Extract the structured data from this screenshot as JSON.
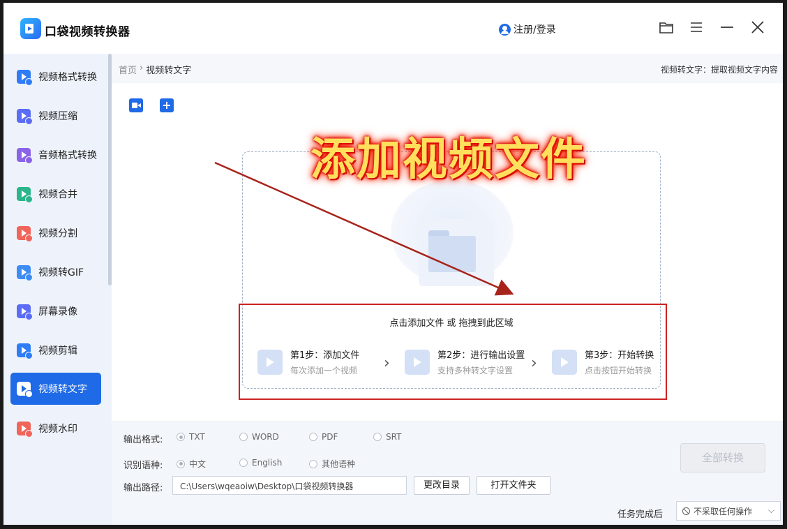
{
  "app": {
    "title": "口袋视频转换器",
    "user_link": "注册/登录"
  },
  "sidebar": {
    "items": [
      {
        "label": "视频格式转换",
        "color": "#2f7cf6"
      },
      {
        "label": "视频压缩",
        "color": "#5b6cf5"
      },
      {
        "label": "音频格式转换",
        "color": "#8a63e8"
      },
      {
        "label": "视频合并",
        "color": "#2bb58a"
      },
      {
        "label": "视频分割",
        "color": "#f0645a"
      },
      {
        "label": "视频转GIF",
        "color": "#3d8cf5"
      },
      {
        "label": "屏幕录像",
        "color": "#5b6cf5"
      },
      {
        "label": "视频剪辑",
        "color": "#2f7cf6"
      },
      {
        "label": "视频转文字",
        "color": "#1f6ae6",
        "active": true
      },
      {
        "label": "视频水印",
        "color": "#f0645a"
      }
    ]
  },
  "breadcrumb": {
    "home": "首页",
    "separator": "›",
    "current": "视频转文字",
    "right_text": "视频转文字：提取视频文字内容"
  },
  "overlay": {
    "title": "添加视频文件"
  },
  "dropzone": {
    "hint": "点击添加文件 或 拖拽到此区域",
    "steps": [
      {
        "title": "第1步：添加文件",
        "sub": "每次添加一个视频"
      },
      {
        "title": "第2步：进行输出设置",
        "sub": "支持多种转文字设置"
      },
      {
        "title": "第3步：开始转换",
        "sub": "点击按钮开始转换"
      }
    ]
  },
  "settings": {
    "format_label": "输出格式:",
    "formats": [
      "TXT",
      "WORD",
      "PDF",
      "SRT"
    ],
    "language_label": "识别语种:",
    "languages": [
      "中文",
      "English",
      "其他语种"
    ],
    "path_label": "输出路径:",
    "path_value": "C:\\Users\\wqeaoiw\\Desktop\\口袋视频转换器",
    "change_dir": "更改目录",
    "open_folder": "打开文件夹",
    "convert_all": "全部转换",
    "after_label": "任务完成后",
    "after_value": "不采取任何操作"
  },
  "colors": {
    "accent": "#1f6ae6",
    "highlight_box": "#cc2222",
    "overlay_text": "#ffdf5c"
  }
}
